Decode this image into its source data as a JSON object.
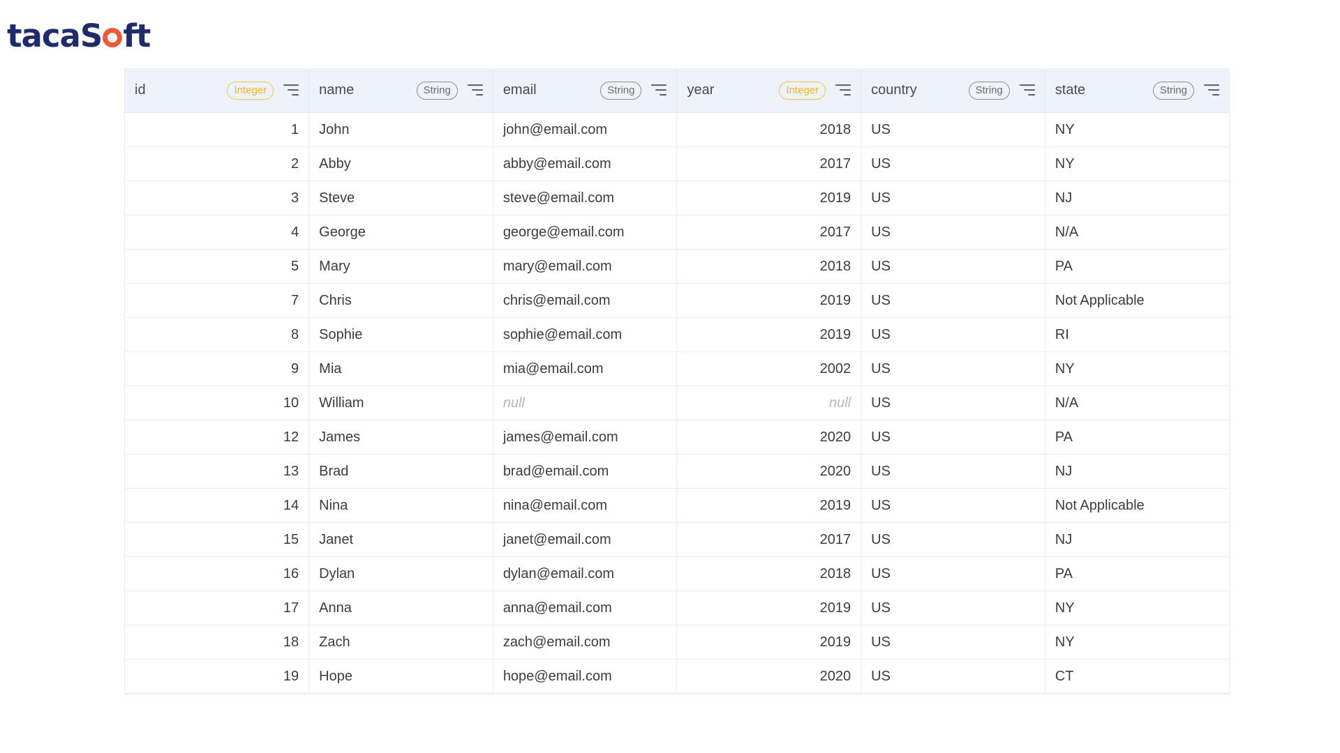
{
  "logo": {
    "part1": "taca",
    "part2": "S",
    "part3": "ft"
  },
  "columns": [
    {
      "name": "id",
      "type": "Integer"
    },
    {
      "name": "name",
      "type": "String"
    },
    {
      "name": "email",
      "type": "String"
    },
    {
      "name": "year",
      "type": "Integer"
    },
    {
      "name": "country",
      "type": "String"
    },
    {
      "name": "state",
      "type": "String"
    }
  ],
  "rows": [
    [
      "1",
      "John",
      "john@email.com",
      "2018",
      "US",
      "NY"
    ],
    [
      "2",
      "Abby",
      "abby@email.com",
      "2017",
      "US",
      "NY"
    ],
    [
      "3",
      "Steve",
      "steve@email.com",
      "2019",
      "US",
      "NJ"
    ],
    [
      "4",
      "George",
      "george@email.com",
      "2017",
      "US",
      "N/A"
    ],
    [
      "5",
      "Mary",
      "mary@email.com",
      "2018",
      "US",
      "PA"
    ],
    [
      "7",
      "Chris",
      "chris@email.com",
      "2019",
      "US",
      "Not Applicable"
    ],
    [
      "8",
      "Sophie",
      "sophie@email.com",
      "2019",
      "US",
      "RI"
    ],
    [
      "9",
      "Mia",
      "mia@email.com",
      "2002",
      "US",
      "NY"
    ],
    [
      "10",
      "William",
      "null",
      "null",
      "US",
      "N/A"
    ],
    [
      "12",
      "James",
      "james@email.com",
      "2020",
      "US",
      "PA"
    ],
    [
      "13",
      "Brad",
      "brad@email.com",
      "2020",
      "US",
      "NJ"
    ],
    [
      "14",
      "Nina",
      "nina@email.com",
      "2019",
      "US",
      "Not Applicable"
    ],
    [
      "15",
      "Janet",
      "janet@email.com",
      "2017",
      "US",
      "NJ"
    ],
    [
      "16",
      "Dylan",
      "dylan@email.com",
      "2018",
      "US",
      "PA"
    ],
    [
      "17",
      "Anna",
      "anna@email.com",
      "2019",
      "US",
      "NY"
    ],
    [
      "18",
      "Zach",
      "zach@email.com",
      "2019",
      "US",
      "NY"
    ],
    [
      "19",
      "Hope",
      "hope@email.com",
      "2020",
      "US",
      "CT"
    ]
  ],
  "colors": {
    "brand_navy": "#1f2b6b",
    "brand_orange": "#ef5b3a",
    "integer_badge": "#f0b428",
    "string_badge": "#6b6b6b",
    "header_bg": "#eef3fb",
    "null_text": "#b8b8b8"
  },
  "icons": {
    "sort": "sort-lines-icon"
  }
}
